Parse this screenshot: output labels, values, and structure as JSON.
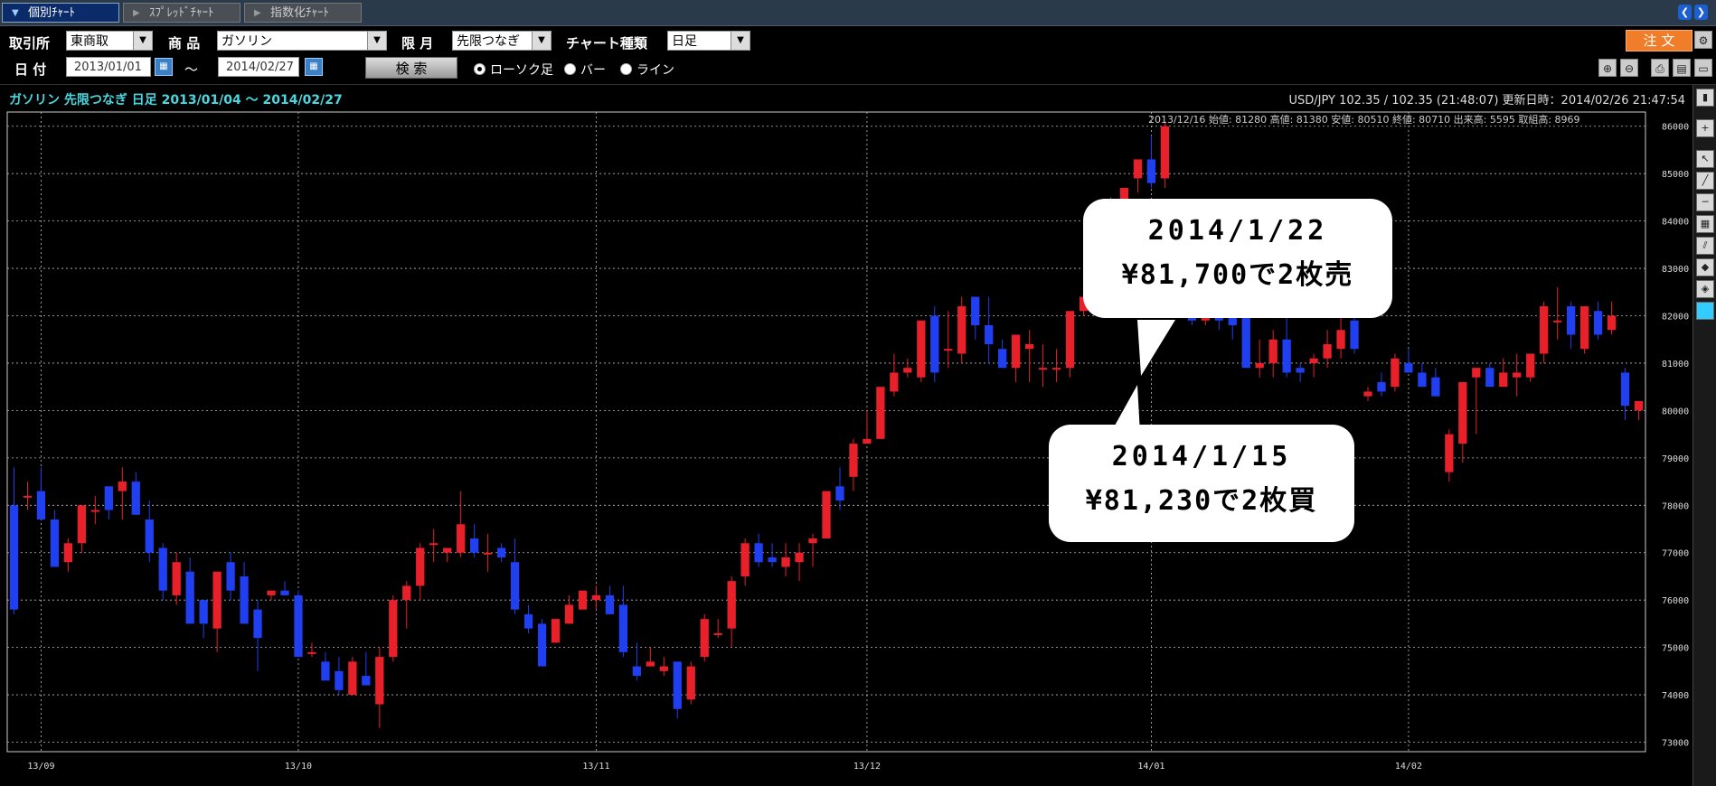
{
  "tabs": [
    {
      "label": "個別ﾁｬｰﾄ",
      "active": true
    },
    {
      "label": "ｽﾌﾟﾚｯﾄﾞﾁｬｰﾄ",
      "active": false
    },
    {
      "label": "指数化ﾁｬｰﾄ",
      "active": false
    }
  ],
  "toolbar": {
    "exchange_label": "取引所",
    "exchange_value": "東商取",
    "product_label": "商 品",
    "product_value": "ガソリン",
    "month_label": "限 月",
    "month_value": "先限つなぎ",
    "charttype_label": "チャート種類",
    "charttype_value": "日足",
    "date_label": "日 付",
    "date_from": "2013/01/01",
    "date_sep": "～",
    "date_to": "2014/02/27",
    "search_label": "検 索",
    "radio_candle": "ローソク足",
    "radio_bar": "バー",
    "radio_line": "ライン",
    "order_label": "注 文"
  },
  "chart_header": {
    "title": "ガソリン 先限つなぎ 日足 2013/01/04 ～ 2014/02/27",
    "quote": "USD/JPY 102.35 / 102.35 (21:48:07) 更新日時：2014/02/26 21:47:54",
    "ohlc": "2013/12/16 始値: 81280 高値: 81380 安値: 80510 終値: 80710 出来高: 5595 取組高: 8969"
  },
  "annotations": {
    "sell_line1": "2014/1/22",
    "sell_line2": "¥81,700で2枚売",
    "buy_line1": "2014/1/15",
    "buy_line2": "¥81,230で2枚買"
  },
  "colors": {
    "up": "#e8202a",
    "down": "#1f3ff0",
    "grid": "#bbbbbb",
    "accent": "#f07d2a"
  },
  "chart_data": {
    "type": "candlestick",
    "title": "ガソリン 先限つなぎ 日足",
    "ylim": [
      72800,
      86300
    ],
    "y_ticks": [
      73000,
      74000,
      75000,
      76000,
      77000,
      78000,
      79000,
      80000,
      81000,
      82000,
      83000,
      84000,
      85000,
      86000
    ],
    "x_ticks": [
      "13/09",
      "13/10",
      "13/11",
      "13/12",
      "14/01",
      "14/02"
    ],
    "x_tick_index": [
      2,
      21,
      43,
      63,
      84,
      103
    ],
    "candles": [
      [
        78000,
        78800,
        75700,
        75800
      ],
      [
        78200,
        78500,
        77900,
        78200
      ],
      [
        78300,
        78800,
        77700,
        77700
      ],
      [
        77700,
        77900,
        76800,
        76700
      ],
      [
        76800,
        77300,
        76600,
        77200
      ],
      [
        77200,
        78000,
        77000,
        78000
      ],
      [
        77900,
        78200,
        77600,
        77900
      ],
      [
        78400,
        78300,
        77700,
        77900
      ],
      [
        78300,
        78800,
        77700,
        78500
      ],
      [
        78500,
        78700,
        77800,
        77800
      ],
      [
        77700,
        78100,
        76800,
        77000
      ],
      [
        77100,
        77200,
        76000,
        76200
      ],
      [
        76100,
        77000,
        75900,
        76800
      ],
      [
        76600,
        76900,
        75600,
        75500
      ],
      [
        76000,
        75900,
        75200,
        75500
      ],
      [
        75400,
        76500,
        74900,
        76600
      ],
      [
        76800,
        77000,
        76000,
        76200
      ],
      [
        76500,
        76800,
        75800,
        75500
      ],
      [
        75800,
        76000,
        74500,
        75200
      ],
      [
        76100,
        76200,
        76000,
        76200
      ],
      [
        76200,
        76400,
        76100,
        76100
      ],
      [
        76100,
        76200,
        74800,
        74800
      ],
      [
        74900,
        75100,
        74800,
        74900
      ],
      [
        74700,
        74900,
        74300,
        74300
      ],
      [
        74500,
        74800,
        74000,
        74100
      ],
      [
        74000,
        74800,
        74300,
        74700
      ],
      [
        74400,
        74900,
        74200,
        74200
      ],
      [
        73800,
        75000,
        73300,
        74800
      ],
      [
        74800,
        76100,
        74700,
        76000
      ],
      [
        76000,
        76400,
        75400,
        76300
      ],
      [
        76300,
        77200,
        76000,
        77100
      ],
      [
        77200,
        77500,
        76800,
        77200
      ],
      [
        77000,
        77100,
        76800,
        77100
      ],
      [
        77000,
        78300,
        76900,
        77600
      ],
      [
        77300,
        77600,
        76900,
        77000
      ],
      [
        77000,
        77400,
        76600,
        77000
      ],
      [
        77100,
        77200,
        76800,
        76900
      ],
      [
        76800,
        77300,
        75700,
        75800
      ],
      [
        75700,
        75900,
        75300,
        75400
      ],
      [
        75500,
        75600,
        74600,
        74600
      ],
      [
        75100,
        75600,
        75100,
        75600
      ],
      [
        75500,
        76100,
        75500,
        75900
      ],
      [
        75800,
        76200,
        75900,
        76200
      ],
      [
        76000,
        76300,
        75800,
        76100
      ],
      [
        76100,
        76300,
        75700,
        75700
      ],
      [
        75900,
        76300,
        74800,
        74900
      ],
      [
        74600,
        75100,
        74300,
        74400
      ],
      [
        74600,
        75000,
        74600,
        74700
      ],
      [
        74500,
        74800,
        74400,
        74600
      ],
      [
        74700,
        74600,
        73500,
        73700
      ],
      [
        73900,
        74700,
        73800,
        74600
      ],
      [
        74800,
        75700,
        74700,
        75600
      ],
      [
        75300,
        75600,
        75200,
        75300
      ],
      [
        75400,
        76500,
        75000,
        76400
      ],
      [
        76500,
        77300,
        76300,
        77200
      ],
      [
        77200,
        77400,
        76700,
        76800
      ],
      [
        76900,
        77200,
        76700,
        76800
      ],
      [
        76700,
        77200,
        76500,
        76900
      ],
      [
        76800,
        77200,
        76400,
        77000
      ],
      [
        77200,
        77400,
        76700,
        77300
      ],
      [
        77300,
        78300,
        77300,
        78300
      ],
      [
        78400,
        78800,
        77900,
        78100
      ],
      [
        78600,
        79400,
        78300,
        79300
      ],
      [
        79300,
        80000,
        79300,
        79400
      ],
      [
        79400,
        80300,
        79400,
        80500
      ],
      [
        80400,
        81200,
        80300,
        80800
      ],
      [
        80800,
        81100,
        80700,
        80900
      ],
      [
        80700,
        81900,
        80600,
        81900
      ],
      [
        82000,
        82200,
        80600,
        80800
      ],
      [
        81300,
        82100,
        80900,
        81300
      ],
      [
        81200,
        82400,
        81000,
        82200
      ],
      [
        82400,
        82400,
        81500,
        81800
      ],
      [
        81800,
        82400,
        81000,
        81400
      ],
      [
        81300,
        81500,
        80900,
        80900
      ],
      [
        80900,
        81600,
        80600,
        81600
      ],
      [
        81300,
        81700,
        80600,
        81400
      ],
      [
        80900,
        81400,
        80500,
        80900
      ],
      [
        80900,
        81300,
        80600,
        80900
      ],
      [
        80900,
        82000,
        80700,
        82100
      ],
      [
        82100,
        82700,
        82000,
        82400
      ],
      [
        82300,
        83200,
        82100,
        83000
      ],
      [
        83000,
        84500,
        83000,
        84400
      ],
      [
        84400,
        84700,
        84200,
        84700
      ],
      [
        84900,
        85000,
        84600,
        85300
      ],
      [
        85300,
        85800,
        84700,
        84800
      ],
      [
        84900,
        86100,
        84700,
        86000
      ],
      [
        82400,
        82700,
        82000,
        82100
      ],
      [
        82100,
        82300,
        81800,
        81900
      ],
      [
        81900,
        82300,
        81800,
        82000
      ],
      [
        82100,
        82300,
        81700,
        81900
      ],
      [
        82000,
        82200,
        81500,
        81800
      ],
      [
        82200,
        82300,
        80900,
        80900
      ],
      [
        80900,
        81500,
        80700,
        81000
      ],
      [
        81000,
        81700,
        80700,
        81500
      ],
      [
        81500,
        82100,
        80700,
        80800
      ],
      [
        80900,
        81000,
        80600,
        80800
      ],
      [
        81000,
        81200,
        80700,
        81100
      ],
      [
        81100,
        81700,
        80900,
        81400
      ],
      [
        81300,
        82000,
        81100,
        81700
      ],
      [
        81900,
        82000,
        81200,
        81300
      ],
      [
        80300,
        80500,
        80200,
        80400
      ],
      [
        80600,
        80800,
        80300,
        80400
      ],
      [
        80500,
        81200,
        80400,
        81100
      ],
      [
        81000,
        81300,
        80900,
        80800
      ],
      [
        80800,
        81000,
        80500,
        80500
      ],
      [
        80700,
        80900,
        80300,
        80300
      ],
      [
        78700,
        79600,
        78500,
        79500
      ],
      [
        79300,
        80200,
        78900,
        80600
      ],
      [
        80700,
        80900,
        79500,
        80900
      ],
      [
        80900,
        81000,
        80500,
        80500
      ],
      [
        80500,
        81100,
        80700,
        80800
      ],
      [
        80700,
        81200,
        80300,
        80800
      ],
      [
        80700,
        81100,
        80600,
        81200
      ],
      [
        81200,
        82300,
        81000,
        82200
      ],
      [
        81900,
        82600,
        81500,
        81900
      ],
      [
        82200,
        82300,
        81300,
        81600
      ],
      [
        81300,
        82200,
        81200,
        82200
      ],
      [
        82100,
        82300,
        81500,
        81600
      ],
      [
        81700,
        82300,
        81600,
        82000
      ],
      [
        80800,
        80900,
        79800,
        80100
      ],
      [
        80000,
        80200,
        79800,
        80200
      ]
    ]
  }
}
